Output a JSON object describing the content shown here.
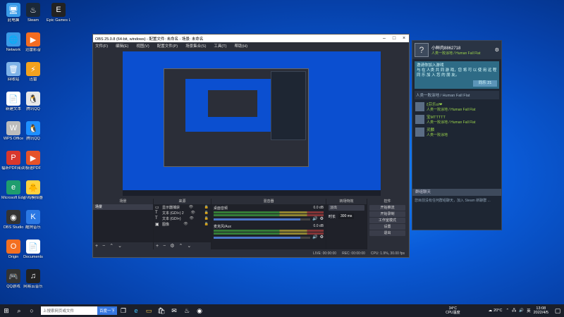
{
  "desktop_icons": [
    {
      "label": "此电脑",
      "icon": "computer-icon",
      "color": "#3a9be8",
      "glyph": "🖥"
    },
    {
      "label": "Steam",
      "icon": "steam-icon",
      "color": "#1b2838",
      "glyph": "♨"
    },
    {
      "label": "Epic Games Launcher",
      "icon": "epic-icon",
      "color": "#222",
      "glyph": "E"
    },
    {
      "label": "Network",
      "icon": "network-icon",
      "color": "#3a9be8",
      "glyph": "🌐"
    },
    {
      "label": "迅雷影音",
      "icon": "xunlei-icon",
      "color": "#f36c21",
      "glyph": "▶"
    },
    {
      "label": "回收站",
      "icon": "recycle-bin-icon",
      "color": "#7fb3e8",
      "glyph": "🗑"
    },
    {
      "label": "迅雷",
      "icon": "thunder-icon",
      "color": "#f3a21e",
      "glyph": "⚡"
    },
    {
      "label": "新建文本",
      "icon": "text-file-icon",
      "color": "#ffffff",
      "glyph": "📄"
    },
    {
      "label": "腾讯QQ",
      "icon": "qq-icon",
      "color": "#e8e8e8",
      "glyph": "🐧"
    },
    {
      "label": "WPS Office",
      "icon": "wps-icon",
      "color": "#bcbcbc",
      "glyph": "W"
    },
    {
      "label": "腾讯QQ",
      "icon": "qq-blue-icon",
      "color": "#1e90ff",
      "glyph": "🐧"
    },
    {
      "label": "福昕PDF阅读器",
      "icon": "pdf-icon",
      "color": "#d8372d",
      "glyph": "P"
    },
    {
      "label": "极速PDF",
      "icon": "pdf2-icon",
      "color": "#e6532a",
      "glyph": "▶"
    },
    {
      "label": "Microsoft Edge",
      "icon": "edge-icon",
      "color": "#1f9d6e",
      "glyph": "e"
    },
    {
      "label": "小鸡模拟器",
      "icon": "emulator-icon",
      "color": "#ffd23f",
      "glyph": "🐥"
    },
    {
      "label": "OBS Studio",
      "icon": "obs-icon",
      "color": "#333",
      "glyph": "◉"
    },
    {
      "label": "酷狗音乐",
      "icon": "kugou-icon",
      "color": "#2b78e4",
      "glyph": "K"
    },
    {
      "label": "Origin",
      "icon": "origin-icon",
      "color": "#f36f21",
      "glyph": "O"
    },
    {
      "label": "Documents",
      "icon": "documents-icon",
      "color": "#ffffff",
      "glyph": "📄"
    },
    {
      "label": "QQ游戏",
      "icon": "qq-game-icon",
      "color": "#333",
      "glyph": "🎮"
    },
    {
      "label": "网易云音乐",
      "icon": "music-icon",
      "color": "#222",
      "glyph": "♫"
    }
  ],
  "obs": {
    "title": "OBS 25.0.8 (64-bit, windows) - 配置文件: 未命名 - 场景: 未命名",
    "menu": [
      "文件(F)",
      "编辑(E)",
      "视图(V)",
      "配置文件(P)",
      "场景集合(S)",
      "工具(T)",
      "帮助(H)"
    ],
    "docks": {
      "scenes": {
        "header": "场景",
        "items": [
          "场景"
        ]
      },
      "sources": {
        "header": "来源",
        "items": [
          {
            "name": "显示器捕获",
            "icon": "monitor-icon"
          },
          {
            "name": "文本 (GDI+) 2",
            "icon": "text-icon"
          },
          {
            "name": "文本 (GDI+)",
            "icon": "text-icon"
          },
          {
            "name": "图像",
            "icon": "image-icon"
          }
        ]
      },
      "mixer": {
        "header": "混音器",
        "channels": [
          {
            "name": "桌面音频",
            "db": "0.0 dB",
            "level": 0.9
          },
          {
            "name": "麦克风/Aux",
            "db": "0.0 dB",
            "level": 0.9
          }
        ]
      },
      "transitions": {
        "header": "转场特效",
        "type": "淡出",
        "duration_label": "时长",
        "duration": "300 ms"
      },
      "controls": {
        "header": "控件",
        "buttons": [
          "开始推流",
          "开始录制",
          "工作室模式",
          "设置",
          "退出"
        ]
      }
    },
    "status": {
      "live": "LIVE: 00:00:00",
      "rec": "REC: 00:00:00",
      "cpu": "CPU: 1.9%, 30.00 fps"
    }
  },
  "steam": {
    "username": "小鲜肉8862718",
    "status": "人类一败涂地 / Human Fall Flat",
    "invite_text": "邀请你加入游戏",
    "invite_detail": "与 在 人类 共 同 游 戏，您 将 可 以 使 用 远 程 同 乐 加 入 您 的 朋 友。",
    "invite_button": "同乐 21",
    "in_game_group": "人类一败涂地 / Human Fall Flat",
    "friends": [
      {
        "name": "ξ芬乐ol❤",
        "game": "人类一败涂地 / Human Fall Flat"
      },
      {
        "name": "宝MTTTTT",
        "game": "人类一败涂地 / Human Fall Flat"
      },
      {
        "name": "灵麟",
        "game": "人类一败涂地"
      }
    ],
    "search_label": "群组聊天",
    "footer": "您目前没有任何群组聊天，加入 Steam 新聊群 ..."
  },
  "taskbar": {
    "search_placeholder": "上搜索网页或文件",
    "baidu_label": "百度一下",
    "weather": "20°C",
    "cpu_temp": "34°C",
    "cpu_label": "CPU温度",
    "time": "13:08",
    "date": "2022/4/5",
    "tray_ime": "英"
  }
}
